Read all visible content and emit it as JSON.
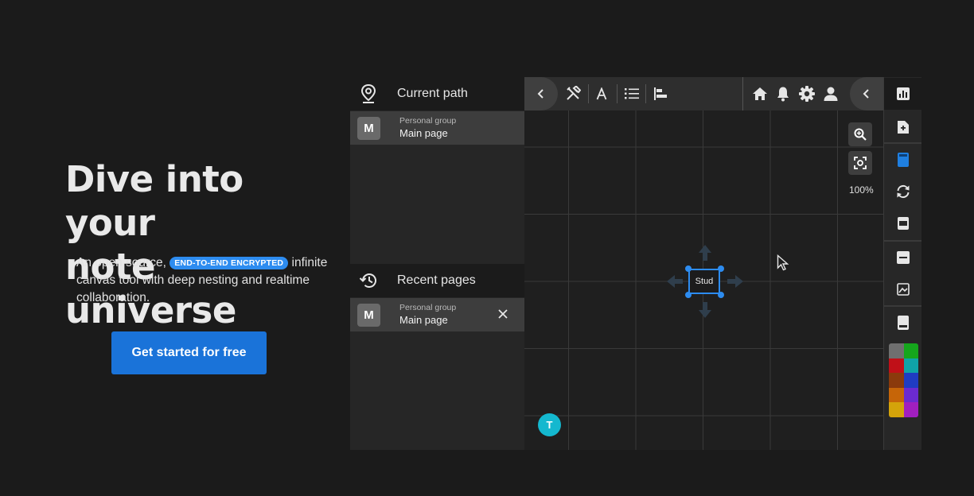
{
  "hero": {
    "title_line1": "Dive into your",
    "title_line2": "note universe",
    "desc_before_badge": "An open source,",
    "badge": "END-TO-END ENCRYPTED",
    "desc_after_badge": "infinite canvas tool with deep nesting and realtime collaboration.",
    "cta_label": "Get started for free"
  },
  "left_panel": {
    "current_path_label": "Current path",
    "current_path_item": {
      "avatar": "M",
      "group": "Personal group",
      "name": "Main page"
    },
    "recent_label": "Recent pages",
    "recent_item": {
      "avatar": "M",
      "group": "Personal group",
      "name": "Main page"
    }
  },
  "toolbar": {
    "left_icons": [
      "chevron-left-icon",
      "tools-icon",
      "text-icon",
      "list-icon",
      "align-left-icon"
    ],
    "right_icons": [
      "home-icon",
      "bell-icon",
      "gear-icon",
      "user-icon",
      "chevron-left-icon"
    ]
  },
  "canvas": {
    "zoom_label": "100%",
    "node_text": "Stud",
    "collaborator_initial": "T"
  },
  "rightbar": {
    "icons": [
      "chart-icon",
      "new-page-icon",
      "note-icon",
      "sync-icon",
      "container-icon",
      "minus-box-icon",
      "image-icon",
      "card-icon"
    ]
  },
  "palette": [
    "#6f6f6f",
    "#15a61c",
    "#c01018",
    "#0fa3a8",
    "#8b3a0c",
    "#1f3cc2",
    "#c66508",
    "#6b2ad0",
    "#d4a30a",
    "#a11fbf"
  ],
  "colors": {
    "accent": "#2d8cf0",
    "cta": "#1a73d9",
    "collaborator": "#14b8cf"
  }
}
